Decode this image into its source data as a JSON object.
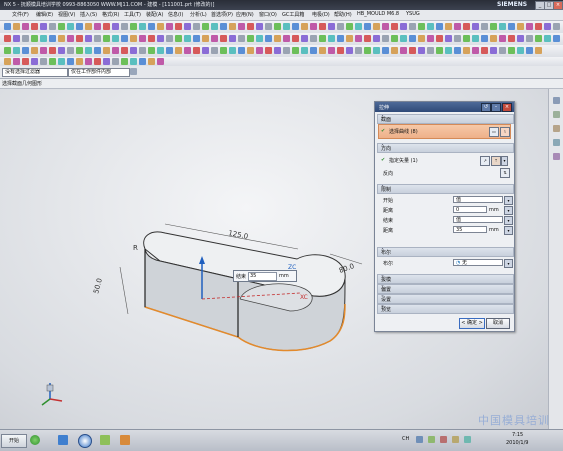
{
  "window": {
    "title": "NX 5 - 抚顺模具培训学校 0993-8863050 WWW.MJ11.COM - 建模 - [111001.prt (修改的)]",
    "brand": "SIEMENS",
    "controls": [
      "_",
      "□",
      "×"
    ]
  },
  "menu": [
    "文件(F)",
    "编辑(E)",
    "视图(V)",
    "插入(S)",
    "格式(R)",
    "工具(T)",
    "装配(A)",
    "信息(I)",
    "分析(L)",
    "首选项(P)",
    "应用(N)",
    "窗口(O)",
    "GC工具箱",
    "电极(D)",
    "帮助(H)",
    "HB_MOULD M6.8",
    "YSUG"
  ],
  "selection_bar": {
    "filter": "没有选择过滤器",
    "scope": "仅在工作部件内部"
  },
  "subtitle": "选择截面几何图形",
  "dialog": {
    "title": "拉伸",
    "sections": {
      "section": {
        "header": "截面",
        "select_curve": "选择曲线 (8)"
      },
      "direction": {
        "header": "方向",
        "specify_vector": "指定矢量 (1)",
        "reverse": "反向"
      },
      "limits": {
        "header": "限制",
        "start_label": "开始",
        "start_value": "值",
        "start_distance_label": "距离",
        "start_distance": "0",
        "end_label": "结束",
        "end_value": "值",
        "end_distance_label": "距离",
        "end_distance": "35",
        "unit": "mm"
      },
      "boolean": {
        "header": "布尔",
        "label": "布尔",
        "value": "无"
      },
      "collapsed": [
        "拔模",
        "偏置",
        "设置",
        "预览"
      ]
    },
    "ok": "< 确定 >",
    "cancel": "取消"
  },
  "viewport": {
    "input_label": "结束",
    "input_value": "35",
    "input_unit": "mm",
    "axis_zc": "ZC",
    "axis_xc": "XC",
    "dim_top": "125.0",
    "dim_left": "50.0",
    "dim_right": "80.0",
    "dim_r": "R"
  },
  "taskbar": {
    "start": "开始",
    "lang": "CH",
    "time": "7:15",
    "date": "2010/1/9"
  },
  "watermark": "中国模具培训"
}
